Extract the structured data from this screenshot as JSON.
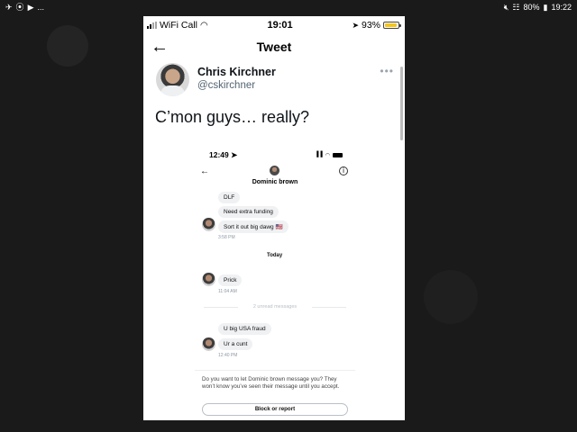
{
  "android_status": {
    "left_icons": [
      "✈",
      "⦿",
      "▶",
      "..."
    ],
    "battery": "80%",
    "time": "19:22"
  },
  "ios_status": {
    "carrier": "WiFi Call",
    "time": "19:01",
    "battery": "93%",
    "battery_color": "#f5c518"
  },
  "header": {
    "back_icon": "←",
    "title": "Tweet"
  },
  "tweet": {
    "author_name": "Chris Kirchner",
    "author_handle": "@cskirchner",
    "more_icon": "•••",
    "text": "C’mon guys… really?"
  },
  "embedded": {
    "time": "12:49",
    "contact_name": "Dominic brown",
    "messages_1": [
      "DLF",
      "Need extra funding",
      "Sort it out big dawg 🇺🇸"
    ],
    "time_1": "3:58 PM",
    "day_divider": "Today",
    "messages_2": [
      "Prick"
    ],
    "time_2": "11:04 AM",
    "unread_label": "2 unread messages",
    "messages_3": [
      "U big USA fraud",
      "Ur a cunt"
    ],
    "time_3": "12:40 PM",
    "request_text": "Do you want to let Dominic brown message you? They won’t know you’ve seen their message until you accept.",
    "block_button": "Block or report"
  }
}
